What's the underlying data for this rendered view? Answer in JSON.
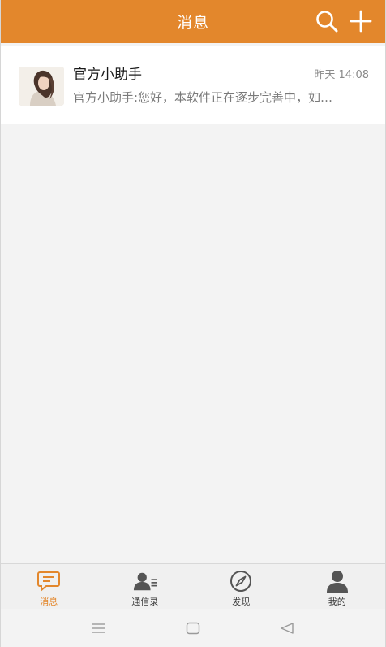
{
  "header": {
    "title": "消息",
    "search_icon": "search-icon",
    "add_icon": "plus-icon",
    "color": "#e3872c"
  },
  "conversations": [
    {
      "name": "官方小助手",
      "time": "昨天 14:08",
      "preview": "官方小助手:您好，本软件正在逐步完善中，如…",
      "avatar": "avatar-photo"
    }
  ],
  "tabs": [
    {
      "label": "消息",
      "icon": "chat-icon",
      "active": true
    },
    {
      "label": "通信录",
      "icon": "contacts-icon",
      "active": false
    },
    {
      "label": "发现",
      "icon": "compass-icon",
      "active": false
    },
    {
      "label": "我的",
      "icon": "person-icon",
      "active": false
    }
  ],
  "system_nav": {
    "menu_icon": "menu-icon",
    "home_icon": "home-icon",
    "back_icon": "back-icon"
  },
  "colors": {
    "accent": "#e3872c",
    "tab_inactive": "#555555",
    "background": "#f3f3f3"
  }
}
